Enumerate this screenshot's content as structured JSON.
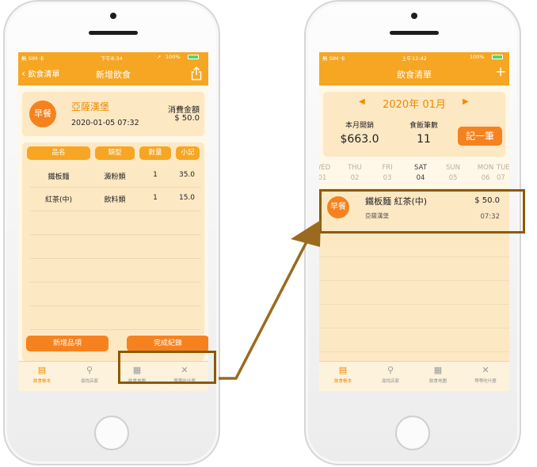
{
  "status_left": {
    "carrier": "無 SIM 卡",
    "time": "下午8:34",
    "battery": "100%"
  },
  "status_right": {
    "carrier": "無 SIM 卡",
    "time": "上午12:42",
    "battery": "100%"
  },
  "left": {
    "nav": {
      "back": "飲食清單",
      "title": "新增飲食"
    },
    "meal": {
      "badge": "早餐",
      "restaurant": "亞薩漢堡",
      "datetime": "2020-01-05 07:32",
      "total_label": "消費金額",
      "total_value": "$ 50.0"
    },
    "columns": [
      "品名",
      "類型",
      "數量",
      "小記"
    ],
    "rows": [
      {
        "name": "鐵板麵",
        "type": "澱粉類",
        "qty": "1",
        "subtotal": "35.0"
      },
      {
        "name": "紅茶(中)",
        "type": "飲料類",
        "qty": "1",
        "subtotal": "15.0"
      }
    ],
    "add_item": "新增品項",
    "finish": "完成紀錄"
  },
  "right": {
    "nav": {
      "title": "飲食清單",
      "add": "+"
    },
    "month": {
      "label": "2020年 01月",
      "prev": "◀",
      "next": "▶"
    },
    "stats": {
      "spend_label": "本月開銷",
      "spend_value": "$663.0",
      "count_label": "食飯筆數",
      "count_value": "11",
      "record": "記一筆"
    },
    "days": [
      {
        "dow": "WED",
        "date": "01"
      },
      {
        "dow": "THU",
        "date": "02"
      },
      {
        "dow": "FRI",
        "date": "03"
      },
      {
        "dow": "SAT",
        "date": "04"
      },
      {
        "dow": "SUN",
        "date": "05"
      },
      {
        "dow": "MON",
        "date": "06"
      },
      {
        "dow": "TUE",
        "date": "07"
      }
    ],
    "entry": {
      "badge": "早餐",
      "items": "鐵板麵 紅茶(中)",
      "restaurant": "亞薩漢堡",
      "price": "$ 50.0",
      "time": "07:32"
    }
  },
  "tabs": [
    "飲食帳本",
    "尋找店家",
    "飲食地圖",
    "等等吃什麼"
  ],
  "colors": {
    "bar": "#f6a623",
    "accent": "#f5821f",
    "highlight": "#8b5a00",
    "card": "#fde8c4"
  }
}
